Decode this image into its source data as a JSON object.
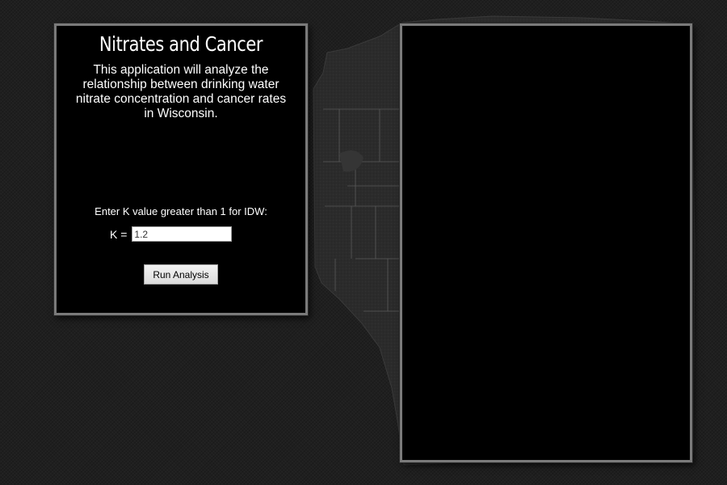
{
  "app": {
    "title": "Nitrates and Cancer",
    "description": "This application will analyze the relationship between drinking water nitrate concentration and cancer rates in Wisconsin."
  },
  "form": {
    "k_prompt": "Enter K value greater than 1 for IDW:",
    "k_label": "K =",
    "k_value": "1.2",
    "run_label": "Run Analysis"
  },
  "colors": {
    "panel_background": "#000000",
    "panel_border": "#7a7a7a",
    "page_background": "#1f1f1f",
    "map_land": "#2b2b2b"
  }
}
